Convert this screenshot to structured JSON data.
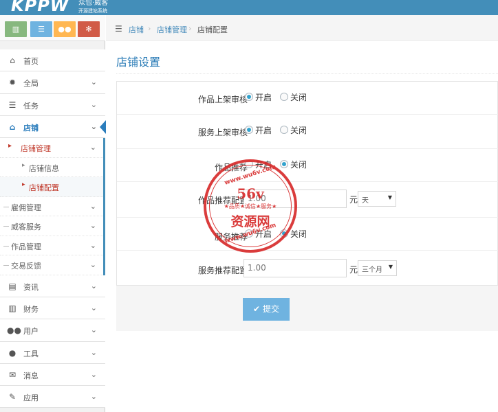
{
  "header": {
    "logo": "KPPW",
    "brand": "众包·威客",
    "tagline": "开源建站系统"
  },
  "shortcuts": [
    {
      "icon": "bar-chart-icon"
    },
    {
      "icon": "list-icon"
    },
    {
      "icon": "users-icon"
    },
    {
      "icon": "cogs-icon"
    }
  ],
  "sidebar": {
    "items": [
      {
        "label": "首页",
        "icon": "home-icon"
      },
      {
        "label": "全局",
        "icon": "gear-icon"
      },
      {
        "label": "任务",
        "icon": "tasks-icon"
      },
      {
        "label": "店铺",
        "icon": "home-icon"
      },
      {
        "label": "资讯",
        "icon": "file-icon"
      },
      {
        "label": "财务",
        "icon": "bar-chart-icon"
      },
      {
        "label": "用户",
        "icon": "users-icon"
      },
      {
        "label": "工具",
        "icon": "user-icon"
      },
      {
        "label": "消息",
        "icon": "envelope-icon"
      },
      {
        "label": "应用",
        "icon": "edit-icon"
      }
    ],
    "sub": {
      "shop_manage": "店铺管理",
      "shop_info": "店铺信息",
      "shop_config": "店铺配置",
      "employ": "雇佣管理",
      "service": "威客服务",
      "works": "作品管理",
      "trade": "交易反馈"
    }
  },
  "breadcrumb": {
    "items": [
      "店铺",
      "店铺管理",
      "店铺配置"
    ],
    "sep": "›"
  },
  "page": {
    "title": "店铺设置"
  },
  "form": {
    "on_label": "开启",
    "off_label": "关闭",
    "rows": [
      {
        "label": "作品上架审核",
        "value": "开启"
      },
      {
        "label": "服务上架审核",
        "value": "开启"
      },
      {
        "label": "作品推荐",
        "value": "关闭"
      },
      {
        "label": "作品推荐配置",
        "input_value": "1.00",
        "unit": "元",
        "select": "天"
      },
      {
        "label": "服务推荐",
        "value": "关闭"
      },
      {
        "label": "服务推荐配置",
        "input_value": "1.00",
        "unit": "元",
        "select": "三个月"
      }
    ],
    "submit_label": "提交"
  },
  "watermark": {
    "url": "www.wu6v.com",
    "big": "56v",
    "slogan": "★品质★诚信★服务★",
    "name": "资源网"
  },
  "colors": {
    "header": "#438eb9",
    "accent": "#2b7dbc",
    "submit": "#6fb3e0",
    "stamp": "#d72828"
  }
}
